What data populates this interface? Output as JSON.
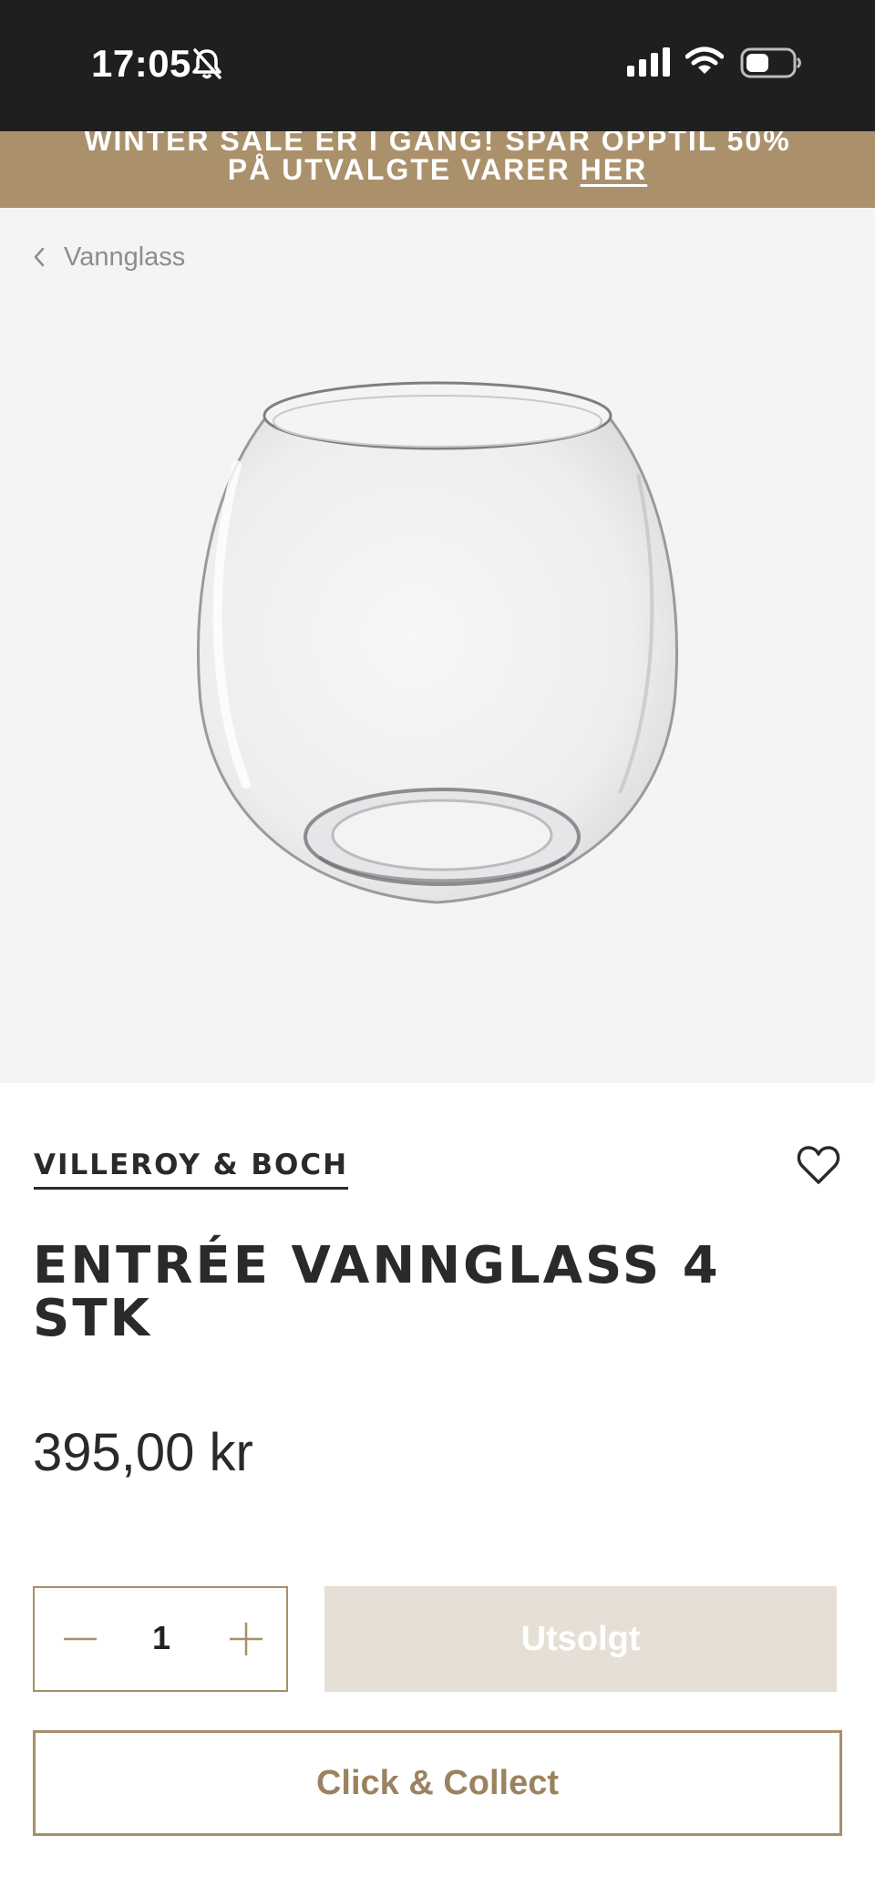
{
  "status_bar": {
    "time": "17:05"
  },
  "promo": {
    "line1": "WINTER SALE ER I GANG! SPAR OPPTIL 50%",
    "line2_text": "PÅ UTVALGTE VARER ",
    "line2_link": "HER",
    "background_color": "#ab916b"
  },
  "breadcrumb": {
    "back_label": "Vannglass"
  },
  "product": {
    "brand": "VILLEROY & BOCH",
    "title": "ENTRÉE VANNGLASS 4 STK",
    "price": "395,00 kr",
    "image_alt": "water glass"
  },
  "purchase": {
    "quantity": "1",
    "soldout_label": "Utsolgt",
    "collect_label": "Click & Collect",
    "accent_color": "#a88f6b"
  }
}
